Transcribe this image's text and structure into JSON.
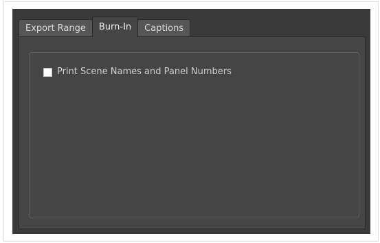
{
  "tabs": [
    {
      "label": "Export Range",
      "active": false
    },
    {
      "label": "Burn-In",
      "active": true
    },
    {
      "label": "Captions",
      "active": false
    }
  ],
  "burn_in": {
    "print_scene_names_checkbox": {
      "label": "Print Scene Names and Panel Numbers",
      "checked": false
    }
  },
  "colors": {
    "dialog_background": "#3a3a3a",
    "panel_background": "#454545",
    "inactive_tab": "#565656",
    "text": "#cfcfcf"
  }
}
